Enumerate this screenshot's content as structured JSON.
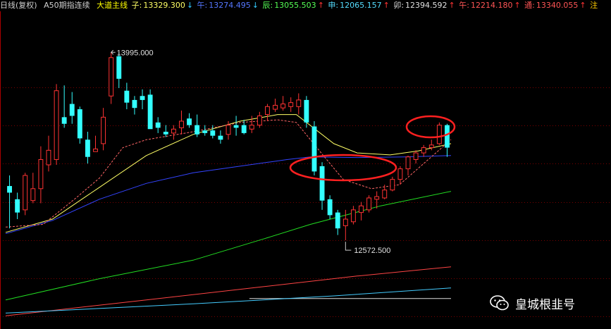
{
  "header": {
    "title": "日线(复权)",
    "instrument": "A50期指连续",
    "indicator_name": "大道主线",
    "ma": [
      {
        "label": "子:",
        "value": "13329.300",
        "arrow": "↓",
        "color": "#ffff66"
      },
      {
        "label": "午:",
        "value": "13274.495",
        "arrow": "↓",
        "color": "#5577ff"
      },
      {
        "label": "辰:",
        "value": "13055.503",
        "arrow": "↑",
        "color": "#55ff55"
      },
      {
        "label": "申:",
        "value": "12065.157",
        "arrow": "↑",
        "color": "#55ddff"
      },
      {
        "label": "卯:",
        "value": "12394.592",
        "arrow": "↑",
        "color": "#e0e0e0"
      },
      {
        "label": "午:",
        "value": "12214.180",
        "arrow": "↑",
        "color": "#ff5555"
      },
      {
        "label": "通:",
        "value": "13340.055",
        "arrow": "↑",
        "color": "#ff5555"
      },
      {
        "label": "注",
        "value": "",
        "arrow": "",
        "color": "#ffcc00"
      }
    ]
  },
  "annotations": {
    "high_label": "13995.000",
    "low_label": "12572.500"
  },
  "watermark": {
    "text": "皇城根韭号",
    "icon": "wechat-icon"
  },
  "colors": {
    "up": "#ff3333",
    "down": "#33ffff",
    "grid": "#7a0000",
    "circle": "#ff2020"
  },
  "chart_data": {
    "type": "candlestick",
    "ylim": [
      11900,
      14300
    ],
    "candles": [
      [
        12980,
        13060,
        12660,
        12930
      ],
      [
        12880,
        12930,
        12730,
        12780
      ],
      [
        12800,
        13080,
        12760,
        13060
      ],
      [
        12870,
        13080,
        12850,
        12960
      ],
      [
        12960,
        13280,
        12850,
        13180
      ],
      [
        13140,
        13360,
        13090,
        13250
      ],
      [
        13180,
        13750,
        13140,
        13700
      ],
      [
        13500,
        13740,
        13420,
        13450
      ],
      [
        13600,
        13690,
        13450,
        13510
      ],
      [
        13560,
        13580,
        13300,
        13340
      ],
      [
        13330,
        13390,
        13150,
        13200
      ],
      [
        13240,
        13360,
        13240,
        13260
      ],
      [
        13300,
        13570,
        13250,
        13500
      ],
      [
        13660,
        13990,
        13600,
        13950
      ],
      [
        13960,
        13990,
        13720,
        13790
      ],
      [
        13700,
        13760,
        13560,
        13610
      ],
      [
        13630,
        13660,
        13520,
        13570
      ],
      [
        13660,
        13710,
        13560,
        13630
      ],
      [
        13670,
        13710,
        13420,
        13410
      ],
      [
        13460,
        13500,
        13380,
        13420
      ],
      [
        13390,
        13440,
        13350,
        13370
      ],
      [
        13380,
        13440,
        13330,
        13410
      ],
      [
        13420,
        13550,
        13370,
        13470
      ],
      [
        13490,
        13530,
        13420,
        13440
      ],
      [
        13440,
        13520,
        13350,
        13370
      ],
      [
        13400,
        13440,
        13360,
        13380
      ],
      [
        13400,
        13440,
        13340,
        13360
      ],
      [
        13360,
        13400,
        13300,
        13330
      ],
      [
        13370,
        13470,
        13330,
        13440
      ],
      [
        13440,
        13510,
        13360,
        13420
      ],
      [
        13440,
        13480,
        13370,
        13380
      ],
      [
        13410,
        13510,
        13380,
        13440
      ],
      [
        13440,
        13540,
        13420,
        13510
      ],
      [
        13520,
        13600,
        13470,
        13580
      ],
      [
        13560,
        13640,
        13540,
        13590
      ],
      [
        13570,
        13660,
        13550,
        13600
      ],
      [
        13580,
        13650,
        13540,
        13610
      ],
      [
        13580,
        13680,
        13520,
        13630
      ],
      [
        13630,
        13660,
        13420,
        13460
      ],
      [
        13430,
        13470,
        13060,
        13090
      ],
      [
        13130,
        13160,
        12800,
        12870
      ],
      [
        12880,
        12910,
        12730,
        12760
      ],
      [
        12780,
        12800,
        12610,
        12660
      ],
      [
        12680,
        12800,
        12570,
        12730
      ],
      [
        12710,
        12830,
        12690,
        12800
      ],
      [
        12780,
        12860,
        12720,
        12830
      ],
      [
        12800,
        12910,
        12780,
        12890
      ],
      [
        12880,
        12940,
        12810,
        12900
      ],
      [
        12890,
        12990,
        12880,
        12950
      ],
      [
        12950,
        13050,
        12940,
        13030
      ],
      [
        13030,
        13130,
        12990,
        13110
      ],
      [
        13110,
        13210,
        13060,
        13200
      ],
      [
        13180,
        13250,
        13150,
        13230
      ],
      [
        13230,
        13290,
        13200,
        13270
      ],
      [
        13270,
        13330,
        13250,
        13290
      ],
      [
        13300,
        13460,
        13290,
        13440
      ],
      [
        13440,
        13450,
        13200,
        13270
      ]
    ],
    "lines": [
      {
        "color": "#ffff66",
        "pts": [
          [
            0,
            12630
          ],
          [
            10,
            12730
          ],
          [
            20,
            12970
          ],
          [
            30,
            13210
          ],
          [
            40,
            13370
          ],
          [
            50,
            13470
          ],
          [
            55,
            13500
          ],
          [
            58,
            13520
          ],
          [
            62,
            13520
          ],
          [
            70,
            13300
          ],
          [
            75,
            13230
          ],
          [
            82,
            13215
          ],
          [
            88,
            13245
          ],
          [
            95,
            13300
          ]
        ]
      },
      {
        "color": "#3344ff",
        "pts": [
          [
            0,
            12620
          ],
          [
            10,
            12720
          ],
          [
            20,
            12880
          ],
          [
            30,
            13000
          ],
          [
            40,
            13080
          ],
          [
            50,
            13130
          ],
          [
            60,
            13180
          ],
          [
            65,
            13200
          ],
          [
            75,
            13195
          ],
          [
            85,
            13200
          ],
          [
            95,
            13210
          ]
        ]
      },
      {
        "color": "#22dd22",
        "pts": [
          [
            0,
            12120
          ],
          [
            20,
            12280
          ],
          [
            40,
            12420
          ],
          [
            55,
            12580
          ],
          [
            65,
            12690
          ],
          [
            80,
            12830
          ],
          [
            95,
            12940
          ]
        ]
      },
      {
        "color": "#dddddd",
        "pts": [
          [
            52,
            12130
          ],
          [
            95,
            12130
          ]
        ]
      },
      {
        "color": "#ff4444",
        "pts": [
          [
            0,
            12000
          ],
          [
            30,
            12120
          ],
          [
            55,
            12220
          ],
          [
            75,
            12300
          ],
          [
            95,
            12370
          ]
        ]
      },
      {
        "color": "#44ccff",
        "pts": [
          [
            0,
            12020
          ],
          [
            40,
            12090
          ],
          [
            70,
            12150
          ],
          [
            95,
            12210
          ]
        ]
      },
      {
        "color": "#ff6666",
        "dash": true,
        "pts": [
          [
            0,
            12670
          ],
          [
            8,
            12690
          ],
          [
            15,
            12890
          ],
          [
            20,
            13040
          ],
          [
            25,
            13270
          ],
          [
            30,
            13330
          ],
          [
            40,
            13390
          ],
          [
            50,
            13460
          ],
          [
            58,
            13480
          ],
          [
            62,
            13460
          ],
          [
            68,
            13200
          ],
          [
            72,
            13030
          ],
          [
            78,
            12960
          ],
          [
            84,
            12990
          ],
          [
            95,
            13330
          ]
        ]
      }
    ]
  }
}
